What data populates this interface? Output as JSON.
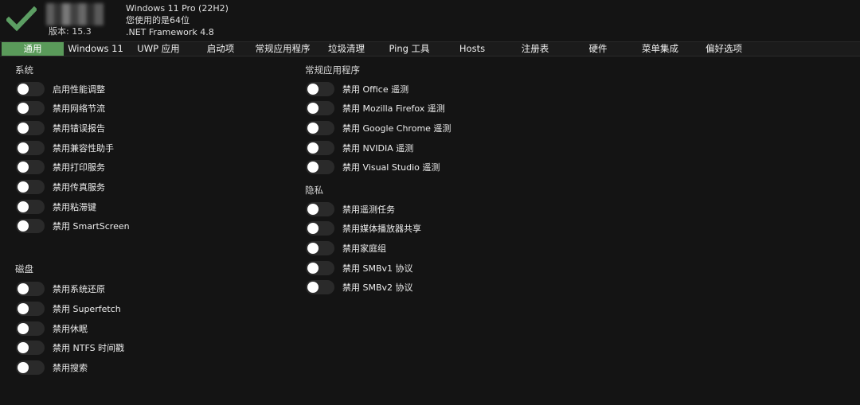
{
  "header": {
    "version": "版本: 15.3",
    "os": "Windows 11 Pro (22H2)",
    "arch": "您使用的是64位",
    "framework": ".NET Framework 4.8"
  },
  "tabs": [
    {
      "label": "通用",
      "active": true
    },
    {
      "label": "Windows 11"
    },
    {
      "label": "UWP 应用"
    },
    {
      "label": "启动项"
    },
    {
      "label": "常规应用程序"
    },
    {
      "label": "垃圾清理"
    },
    {
      "label": "Ping 工具"
    },
    {
      "label": "Hosts"
    },
    {
      "label": "注册表"
    },
    {
      "label": "硬件"
    },
    {
      "label": "菜单集成"
    },
    {
      "label": "偏好选项"
    }
  ],
  "sections": {
    "system": {
      "title": "系统",
      "items": [
        "启用性能调整",
        "禁用网络节流",
        "禁用错误报告",
        "禁用兼容性助手",
        "禁用打印服务",
        "禁用传真服务",
        "禁用粘滞键",
        "禁用 SmartScreen"
      ]
    },
    "disk": {
      "title": "磁盘",
      "items": [
        "禁用系统还原",
        "禁用 Superfetch",
        "禁用休眠",
        "禁用 NTFS 时间戳",
        "禁用搜索"
      ]
    },
    "apps": {
      "title": "常规应用程序",
      "items": [
        "禁用 Office 遥测",
        "禁用 Mozilla Firefox 遥测",
        "禁用 Google Chrome 遥测",
        "禁用 NVIDIA 遥测",
        "禁用 Visual Studio 遥测"
      ]
    },
    "privacy": {
      "title": "隐私",
      "items": [
        "禁用遥测任务",
        "禁用媒体播放器共享",
        "禁用家庭组",
        "禁用 SMBv1 协议",
        "禁用 SMBv2 协议"
      ]
    }
  },
  "colors": {
    "accent": "#5a9a5a",
    "check": "#5c9e63",
    "toggle_off": "#2a2a2a",
    "background": "#141414"
  }
}
